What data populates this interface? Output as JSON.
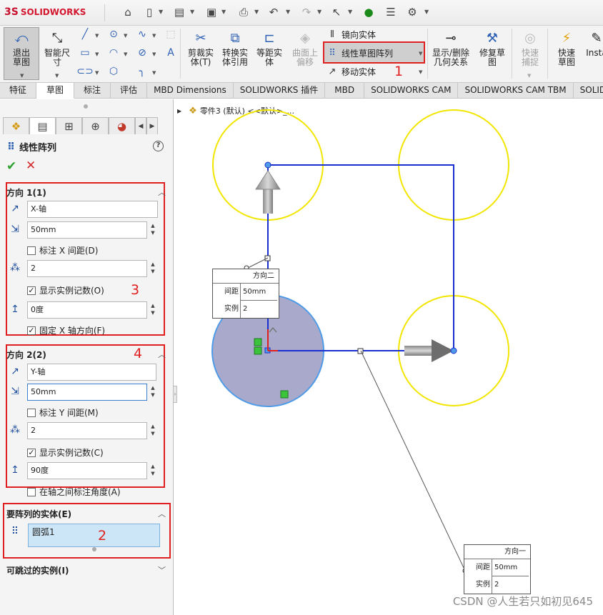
{
  "app": {
    "logo_prefix": "3S",
    "logo_text": "SOLIDWORKS"
  },
  "ribbon": {
    "exit_sketch": "退出草图",
    "smart_dimension": "智能尺寸",
    "trim": "剪裁实体(T)",
    "convert": "转换实体引用",
    "offset": "等距实体",
    "surface_offset": "曲面上偏移",
    "mirror": "镜向实体",
    "linear_pattern": "线性草图阵列",
    "move": "移动实体",
    "show_delete_relations": "显示/删除几何关系",
    "repair": "修复草图",
    "quick_snaps": "快速捕捉",
    "rapid_sketch": "快速草图",
    "instant": "Insta"
  },
  "tabs": [
    "特征",
    "草图",
    "标注",
    "评估",
    "MBD Dimensions",
    "SOLIDWORKS 插件",
    "MBD",
    "SOLIDWORKS CAM",
    "SOLIDWORKS CAM TBM",
    "SOLIDWORK"
  ],
  "panel": {
    "title": "线性阵列",
    "dir1": {
      "head": "方向 1(1)",
      "axis": "X-轴",
      "spacing": "50mm",
      "dim_label": "标注 X 间距(D)",
      "count": "2",
      "show_count": "显示实例记数(O)",
      "angle": "0度",
      "fix_axis": "固定 X 轴方向(F)"
    },
    "dir2": {
      "head": "方向 2(2)",
      "axis": "Y-轴",
      "spacing": "50mm",
      "dim_label": "标注 Y 间距(M)",
      "count": "2",
      "show_count": "显示实例记数(C)",
      "angle": "90度",
      "angle_between": "在轴之间标注角度(A)"
    },
    "entities": {
      "head": "要阵列的实体(E)",
      "item": "圆弧1"
    },
    "skip": {
      "head": "可跳过的实例(I)"
    }
  },
  "annotations": [
    "1",
    "2",
    "3",
    "4"
  ],
  "canvas": {
    "tree": "零件3 (默认) <<默认>_...",
    "callout_dir2": {
      "title": "方向二",
      "spacing_label": "间距",
      "spacing": "50mm",
      "count_label": "实例",
      "count": "2"
    },
    "callout_dir1": {
      "title": "方向一",
      "spacing_label": "间距",
      "spacing": "50mm",
      "count_label": "实例",
      "count": "2"
    }
  },
  "watermark": "CSDN @人生若只如初见645",
  "colors": {
    "highlight_red": "#e02020",
    "circle_yellow": "#f2e600",
    "sketch_blue": "#1a2fcf"
  }
}
